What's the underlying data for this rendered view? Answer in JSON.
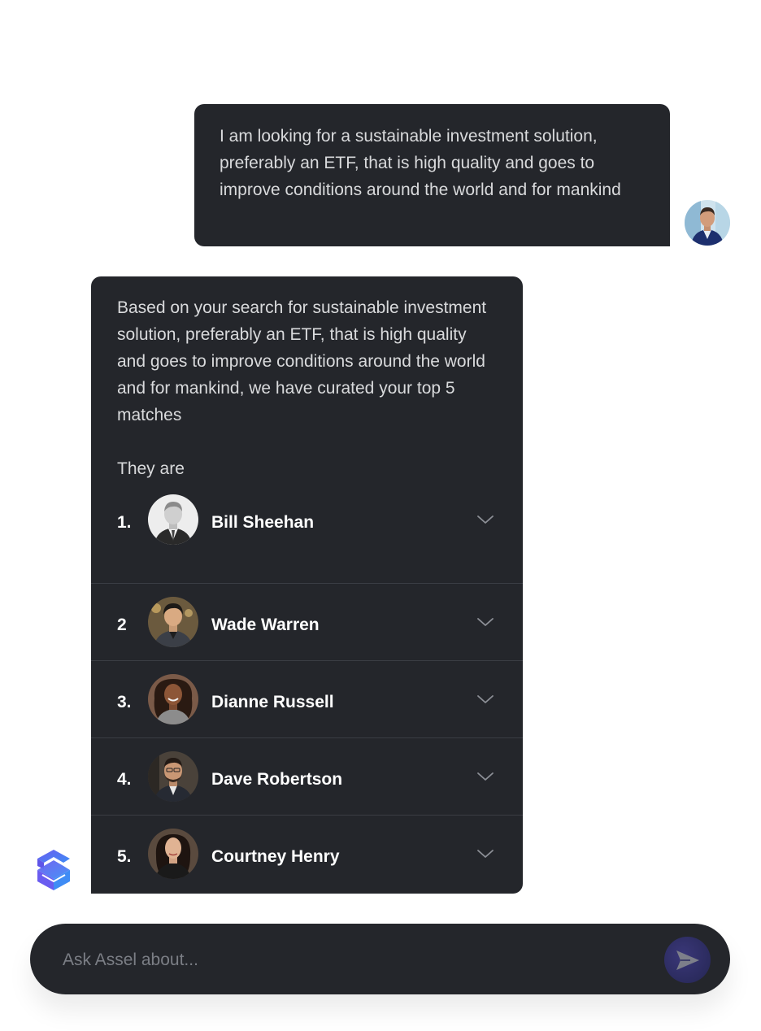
{
  "user_message": {
    "text": "I am looking for a sustainable investment solution, preferably an ETF, that is high quality and goes to improve conditions around the world and for mankind"
  },
  "bot_message": {
    "intro": "Based on your search for sustainable investment solution, preferably an ETF, that is high quality and goes to improve conditions around the world and for mankind, we have curated your top 5 matches",
    "they_are": "They are",
    "matches": [
      {
        "num": "1.",
        "name": "Bill Sheehan"
      },
      {
        "num": "2",
        "name": "Wade Warren"
      },
      {
        "num": "3.",
        "name": "Dianne Russell"
      },
      {
        "num": "4.",
        "name": "Dave Robertson"
      },
      {
        "num": "5.",
        "name": "Courtney Henry"
      }
    ]
  },
  "input": {
    "placeholder": "Ask Assel about..."
  },
  "colors": {
    "bubble": "#24262b",
    "logo_purple": "#6a5cf0",
    "logo_blue": "#3f8cf5",
    "send_button": "#2b2b5e"
  }
}
